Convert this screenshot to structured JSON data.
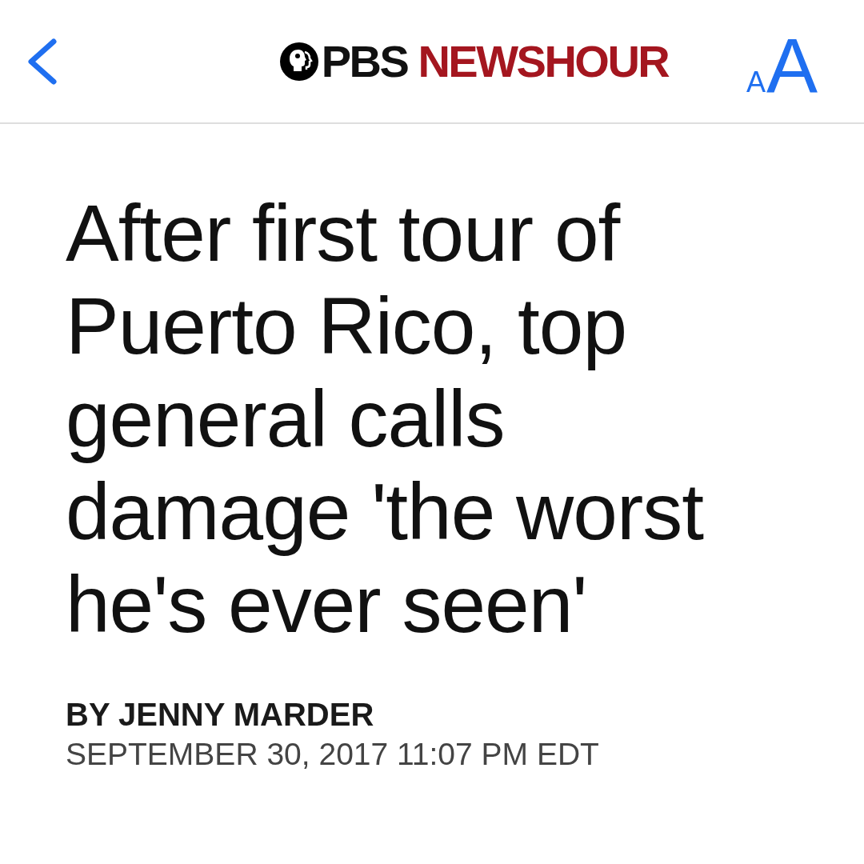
{
  "header": {
    "logo": {
      "part_1": "PBS",
      "part_2": "NEWSHOUR"
    },
    "text_size_button": {
      "small": "A",
      "large": "A"
    }
  },
  "article": {
    "headline": "After first tour of Puerto Rico, top general calls damage 'the worst he's ever seen'",
    "byline": "BY JENNY MARDER",
    "dateline": "SEPTEMBER 30, 2017 11:07 PM EDT"
  }
}
